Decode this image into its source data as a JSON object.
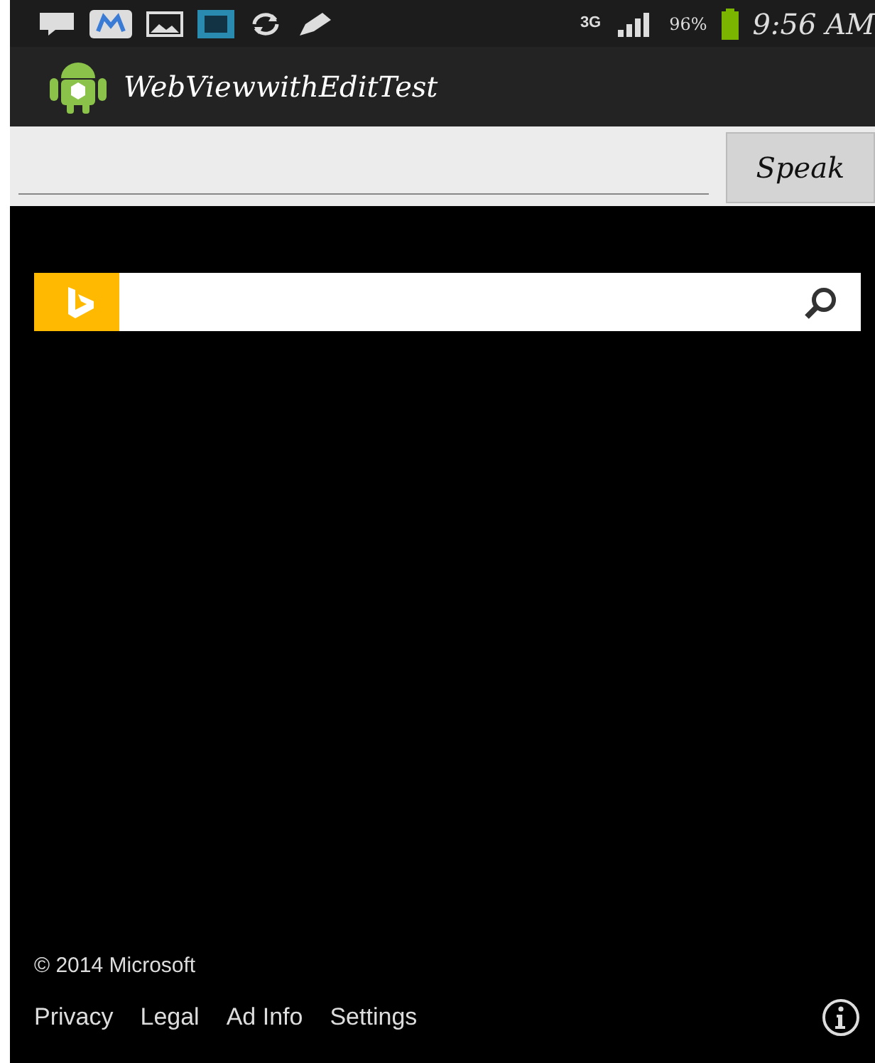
{
  "status_bar": {
    "network": "3G",
    "battery": "96%",
    "time": "9:56 AM"
  },
  "app_bar": {
    "title": "WebViewwithEditTest"
  },
  "input_row": {
    "button": "Speak"
  },
  "web_page": {
    "search": {
      "kind": "bing"
    },
    "copyright": "© 2014 Microsoft",
    "links": [
      "Privacy",
      "Legal",
      "Ad Info",
      "Settings"
    ]
  }
}
